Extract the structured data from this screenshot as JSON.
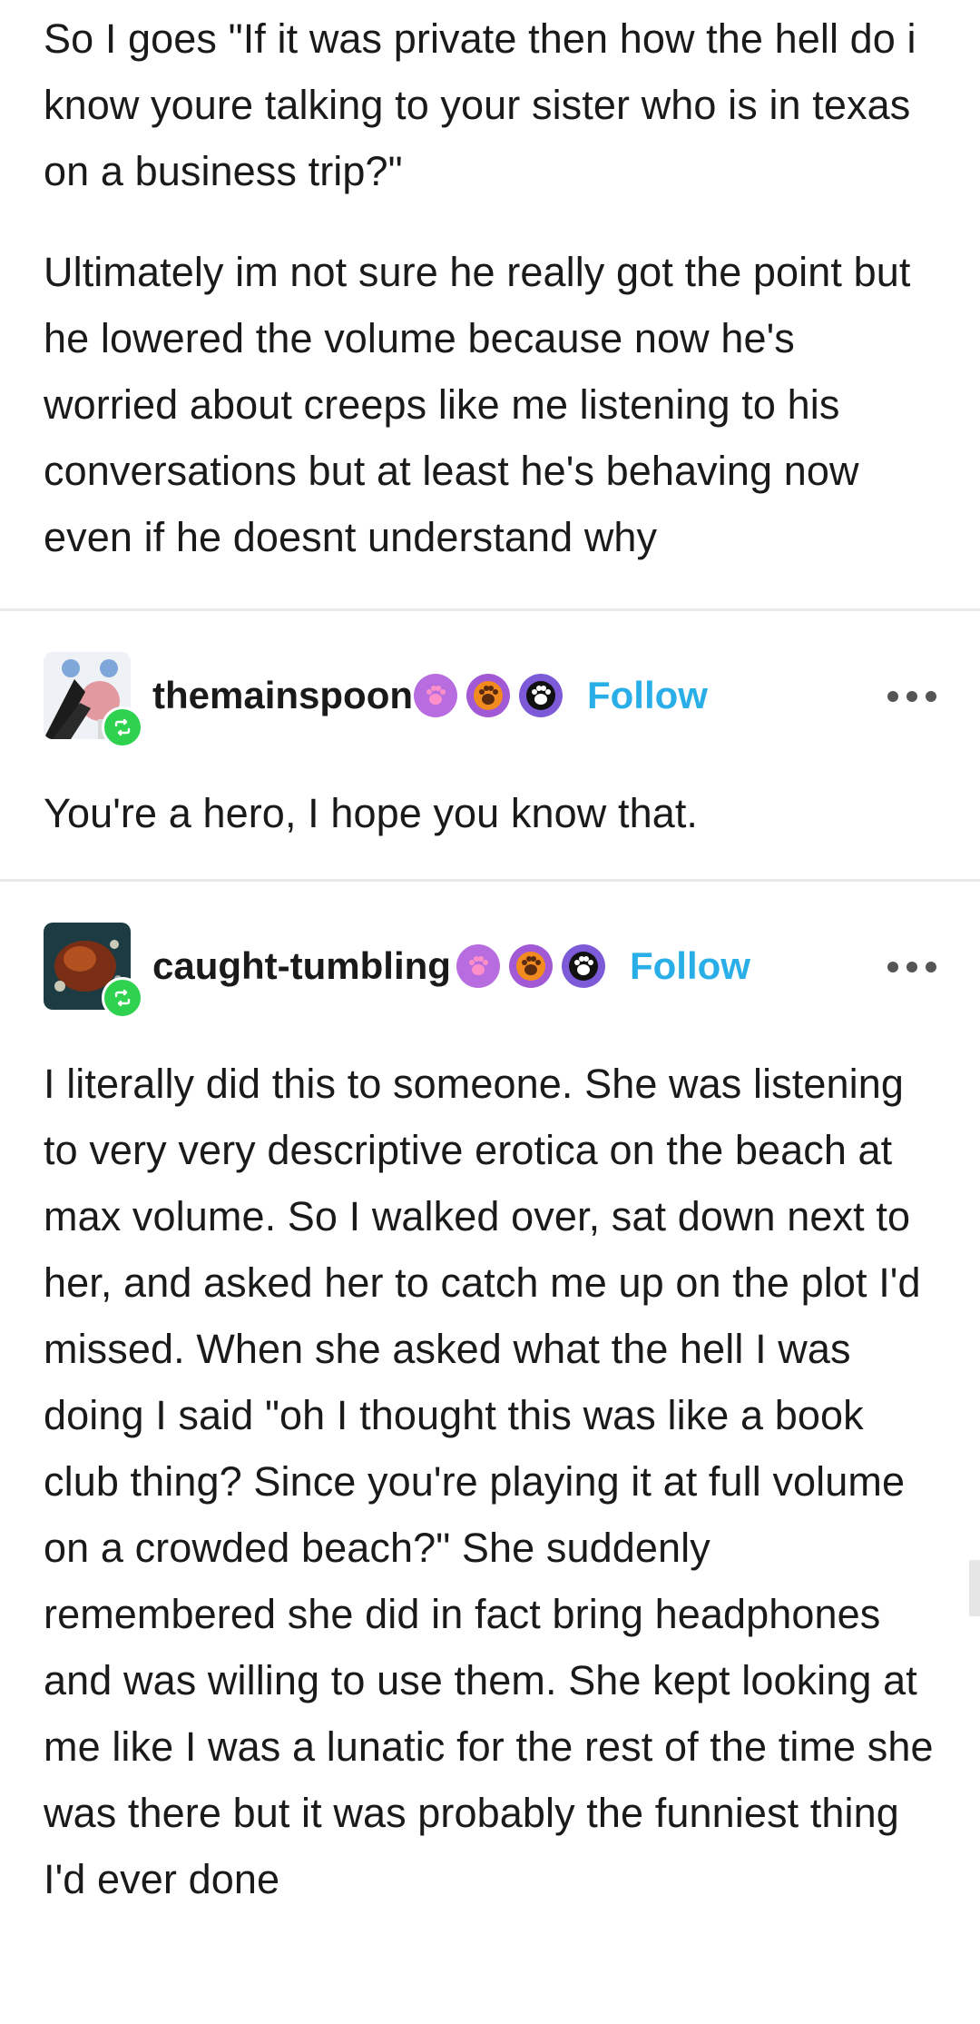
{
  "post_body": {
    "paragraphs": [
      "So I goes \"If it was private then how the hell do i know youre talking to your sister who is in texas on a business trip?\"",
      "Ultimately im not sure he really got the point but he lowered the volume because now he's worried about creeps like me listening to his conversations but at least he's behaving now even if he doesnt understand why"
    ]
  },
  "reblogs": [
    {
      "username": "themainspoon",
      "follow_label": "Follow",
      "text": "You're a hero, I hope you know that."
    },
    {
      "username": "caught-tumbling",
      "follow_label": "Follow",
      "text": "I literally did this to someone. She was listening to very very descriptive erotica on the beach at max volume. So I walked over, sat down next to her, and asked her to catch me up on the plot I'd missed. When she asked what the hell I was doing I said \"oh I thought this was like a book club thing? Since you're playing it at full volume on a crowded beach?\" She suddenly remembered she did in fact bring headphones and was willing to use them. She kept looking at me like I was a lunatic for the rest of the time she was there but it was probably the funniest thing I'd ever done"
    }
  ],
  "colors": {
    "follow": "#2aaee8",
    "reblog_badge": "#2ed24f",
    "divider": "#e9e9e9"
  },
  "icons": {
    "reblog": "reblog-icon",
    "paw_badges": [
      "paw-badge-pink",
      "paw-badge-orange",
      "paw-badge-black"
    ],
    "more": "more-options-icon"
  }
}
